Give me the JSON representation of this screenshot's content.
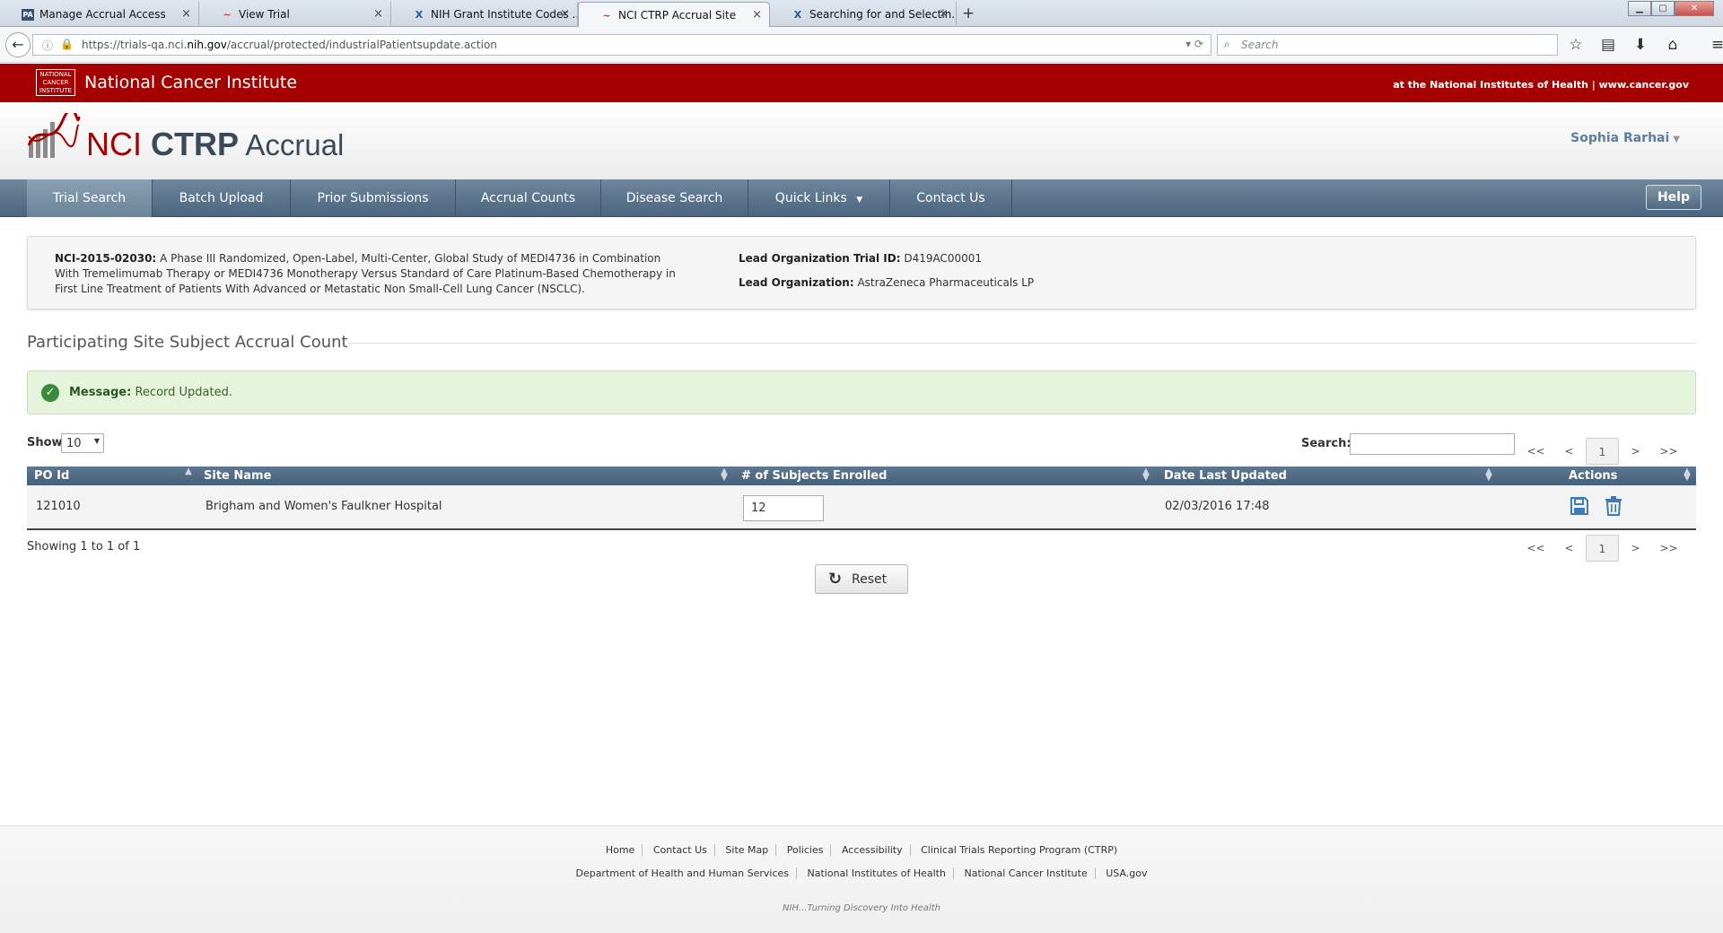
{
  "browser": {
    "tabs": [
      {
        "label": "Manage Accrual Access",
        "icon": "PA"
      },
      {
        "label": "View Trial",
        "icon": "~"
      },
      {
        "label": "NIH Grant Institute Codes ...",
        "icon": "X"
      },
      {
        "label": "NCI CTRP Accrual Site",
        "icon": "~"
      },
      {
        "label": "Searching for and Selectin...",
        "icon": "X"
      }
    ],
    "url_prefix": "https://trials-qa.nci.",
    "url_host": "nih.gov",
    "url_path": "/accrual/protected/industrialPatientsupdate.action",
    "search_placeholder": "Search"
  },
  "banner": {
    "logo_text": "NATIONAL CANCER INSTITUTE",
    "title": "National Cancer Institute",
    "right_text": "at the National Institutes of Health | www.cancer.gov"
  },
  "header": {
    "brand_nci": "NCI ",
    "brand_ctrp": "CTRP",
    "brand_accrual": " Accrual",
    "user": "Sophia Rarhai"
  },
  "menu": {
    "items": [
      "Trial Search",
      "Batch Upload",
      "Prior Submissions",
      "Accrual Counts",
      "Disease Search",
      "Quick Links",
      "Contact Us"
    ],
    "help": "Help"
  },
  "trial": {
    "id": "NCI-2015-02030:",
    "title": "A Phase III Randomized, Open-Label, Multi-Center, Global Study of MEDI4736 in Combination With Tremelimumab Therapy or MEDI4736 Monotherapy Versus Standard of Care Platinum-Based Chemotherapy in First Line Treatment of Patients With Advanced or Metastatic Non Small-Cell Lung Cancer (NSCLC).",
    "lead_trial_id_label": "Lead Organization Trial ID:",
    "lead_trial_id": "D419AC00001",
    "lead_org_label": "Lead Organization:",
    "lead_org": "AstraZeneca Pharmaceuticals LP"
  },
  "section_title": "Participating Site Subject Accrual Count",
  "message": {
    "label": "Message:",
    "text": "Record Updated."
  },
  "table_controls": {
    "show_label": "Show",
    "show_value": "10",
    "search_label": "Search:",
    "pager": [
      "<<",
      "<",
      "1",
      ">",
      ">>"
    ]
  },
  "table": {
    "headers": [
      "PO Id",
      "Site Name",
      "# of Subjects Enrolled",
      "Date Last Updated",
      "Actions"
    ],
    "rows": [
      {
        "po_id": "121010",
        "site": "Brigham and Women's Faulkner Hospital",
        "enrolled": "12",
        "updated": "02/03/2016 17:48"
      }
    ],
    "showing": "Showing 1 to 1 of 1"
  },
  "reset_label": "Reset",
  "footer": {
    "row1": [
      "Home",
      "Contact Us",
      "Site Map",
      "Policies",
      "Accessibility",
      "Clinical Trials Reporting Program (CTRP)"
    ],
    "row2": [
      "Department of Health and Human Services",
      "National Institutes of Health",
      "National Cancer Institute",
      "USA.gov"
    ],
    "tagline": "NIH...Turning Discovery Into Health"
  }
}
